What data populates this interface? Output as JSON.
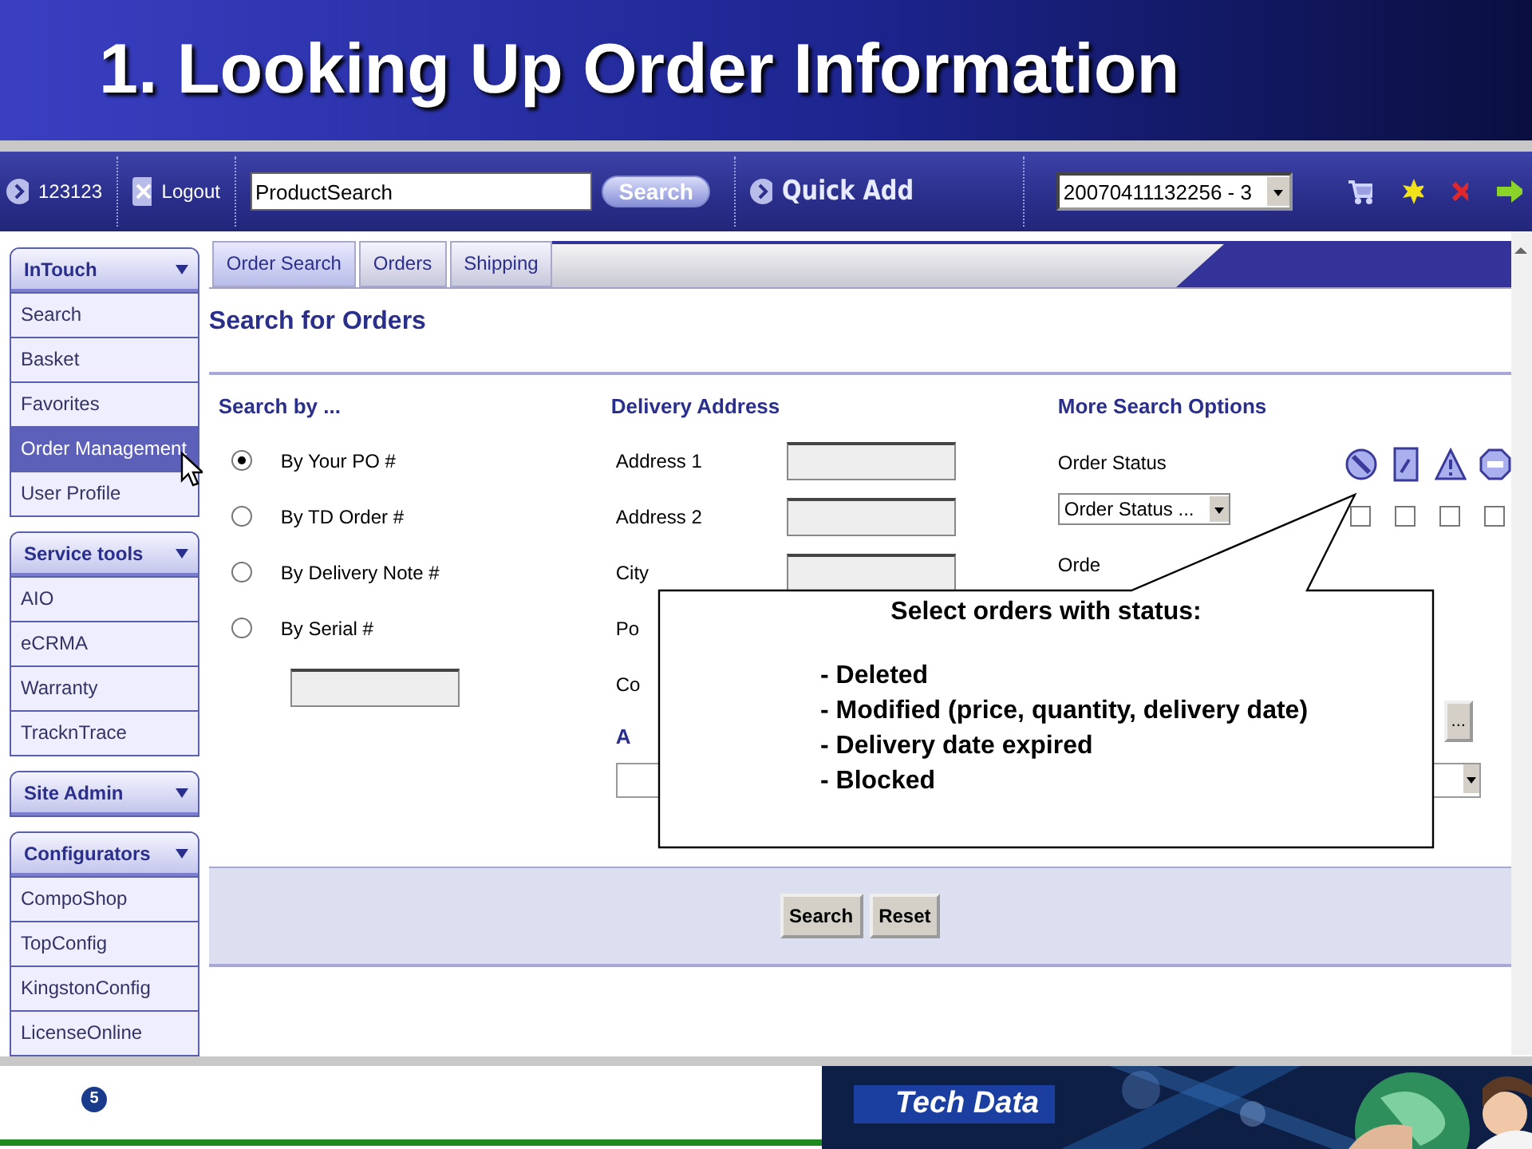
{
  "slide": {
    "title": "1. Looking Up Order Information",
    "page_number": "5",
    "logo": "Tech Data"
  },
  "toolbar": {
    "user": "123123",
    "logout": "Logout",
    "search_value": "ProductSearch",
    "search_button": "Search",
    "quick_add": "Quick Add",
    "basket_select": "20070411132256 - 3"
  },
  "sidebar": [
    {
      "title": "InTouch",
      "items": [
        {
          "label": "Search",
          "selected": false
        },
        {
          "label": "Basket",
          "selected": false
        },
        {
          "label": "Favorites",
          "selected": false
        },
        {
          "label": "Order Management",
          "selected": true
        },
        {
          "label": "User Profile",
          "selected": false
        }
      ]
    },
    {
      "title": "Service tools",
      "items": [
        {
          "label": "AIO",
          "selected": false
        },
        {
          "label": "eCRMA",
          "selected": false
        },
        {
          "label": "Warranty",
          "selected": false
        },
        {
          "label": "TracknTrace",
          "selected": false
        }
      ]
    },
    {
      "title": "Site Admin"
    },
    {
      "title": "Configurators",
      "items": [
        {
          "label": "CompoShop",
          "selected": false
        },
        {
          "label": "TopConfig",
          "selected": false
        },
        {
          "label": "KingstonConfig",
          "selected": false
        },
        {
          "label": "LicenseOnline",
          "selected": false
        }
      ]
    }
  ],
  "tabs": [
    {
      "label": "Order Search",
      "selected": true
    },
    {
      "label": "Orders",
      "selected": false
    },
    {
      "label": "Shipping",
      "selected": false
    }
  ],
  "heading": "Search for Orders",
  "search_by": {
    "title": "Search by ...",
    "options": [
      {
        "label": "By Your PO #",
        "selected": true
      },
      {
        "label": "By TD Order #",
        "selected": false
      },
      {
        "label": "By Delivery Note #",
        "selected": false
      },
      {
        "label": "By Serial #",
        "selected": false
      }
    ]
  },
  "delivery_address": {
    "title": "Delivery Address",
    "fields": [
      {
        "label": "Address 1",
        "kind": "input"
      },
      {
        "label": "Address 2",
        "kind": "input"
      },
      {
        "label": "City",
        "kind": "input"
      },
      {
        "label": "Po",
        "kind": "label"
      },
      {
        "label": "Co",
        "kind": "label"
      }
    ],
    "next_heading": "A"
  },
  "more_options": {
    "title": "More Search Options",
    "status_label": "Order Status",
    "status_select": "Order Status ...",
    "next_label": "Orde",
    "browse_button": "...",
    "status_icons": [
      {
        "kind": "deleted",
        "checked": false
      },
      {
        "kind": "modified",
        "checked": false
      },
      {
        "kind": "expired",
        "checked": false
      },
      {
        "kind": "blocked",
        "checked": false
      }
    ]
  },
  "buttons": [
    "Search",
    "Reset"
  ],
  "callout": {
    "title": "Select orders with status:",
    "lines": [
      "- Deleted",
      "- Modified (price, quantity, delivery date)",
      "- Delivery date expired",
      "- Blocked"
    ]
  }
}
